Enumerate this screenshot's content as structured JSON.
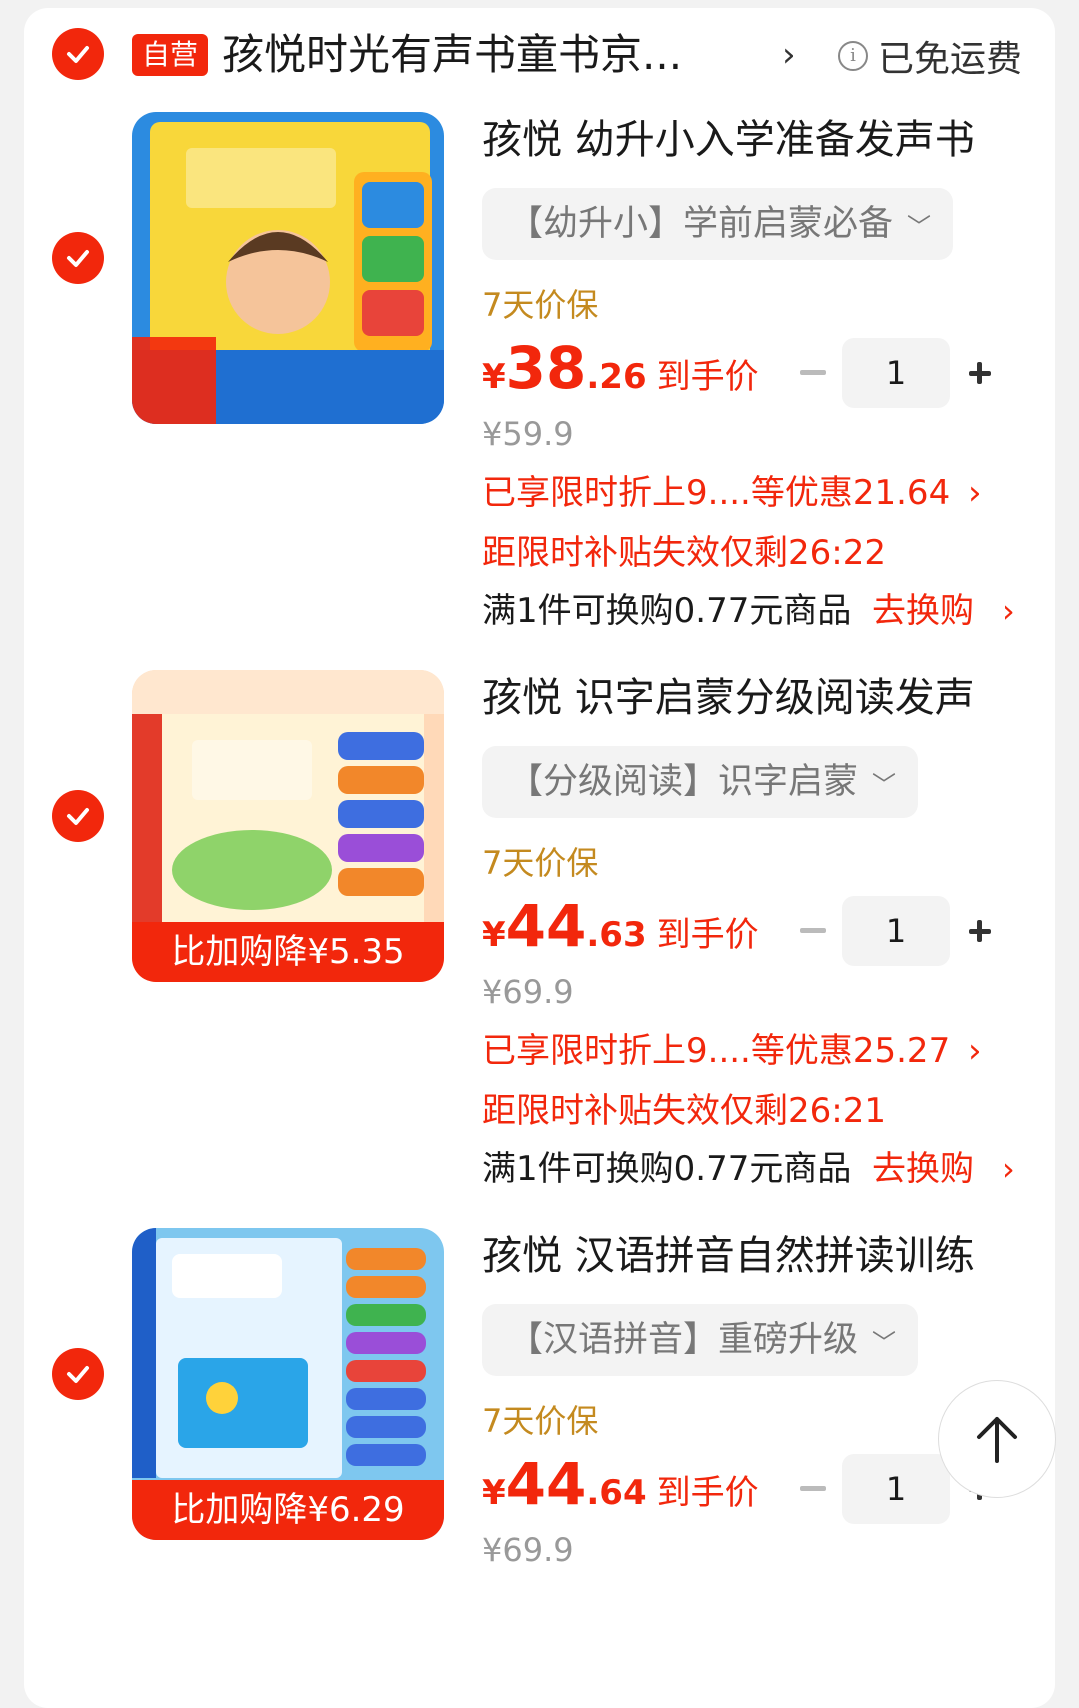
{
  "store": {
    "badge": "自营",
    "name": "孩悦时光有声书童书京...",
    "chevron": "›",
    "info_icon": "i",
    "shipping": "已免运费"
  },
  "colors": {
    "accent": "#f2270c",
    "guarantee": "#c48a1f",
    "muted": "#999999"
  },
  "items": [
    {
      "title": "孩悦 幼升小入学准备发声书",
      "spec": "【幼升小】学前启蒙必备",
      "guarantee": "7天价保",
      "price_currency": "¥",
      "price_int": "38",
      "price_dec": ".26",
      "price_label": "到手价",
      "qty": "1",
      "original_price": "¥59.9",
      "promo": "已享限时折上9....等优惠21.64",
      "countdown": "距限时补贴失效仅剩26:22",
      "swap_text": "满1件可换购0.77元商品",
      "swap_link": "去换购",
      "thumb_label": ""
    },
    {
      "title": "孩悦 识字启蒙分级阅读发声",
      "spec": "【分级阅读】识字启蒙",
      "guarantee": "7天价保",
      "price_currency": "¥",
      "price_int": "44",
      "price_dec": ".63",
      "price_label": "到手价",
      "qty": "1",
      "original_price": "¥69.9",
      "promo": "已享限时折上9....等优惠25.27",
      "countdown": "距限时补贴失效仅剩26:21",
      "swap_text": "满1件可换购0.77元商品",
      "swap_link": "去换购",
      "thumb_label": "比加购降¥5.35"
    },
    {
      "title": "孩悦 汉语拼音自然拼读训练",
      "spec": "【汉语拼音】重磅升级",
      "guarantee": "7天价保",
      "price_currency": "¥",
      "price_int": "44",
      "price_dec": ".64",
      "price_label": "到手价",
      "qty": "1",
      "original_price": "¥69.9",
      "thumb_label": "比加购降¥6.29"
    }
  ]
}
